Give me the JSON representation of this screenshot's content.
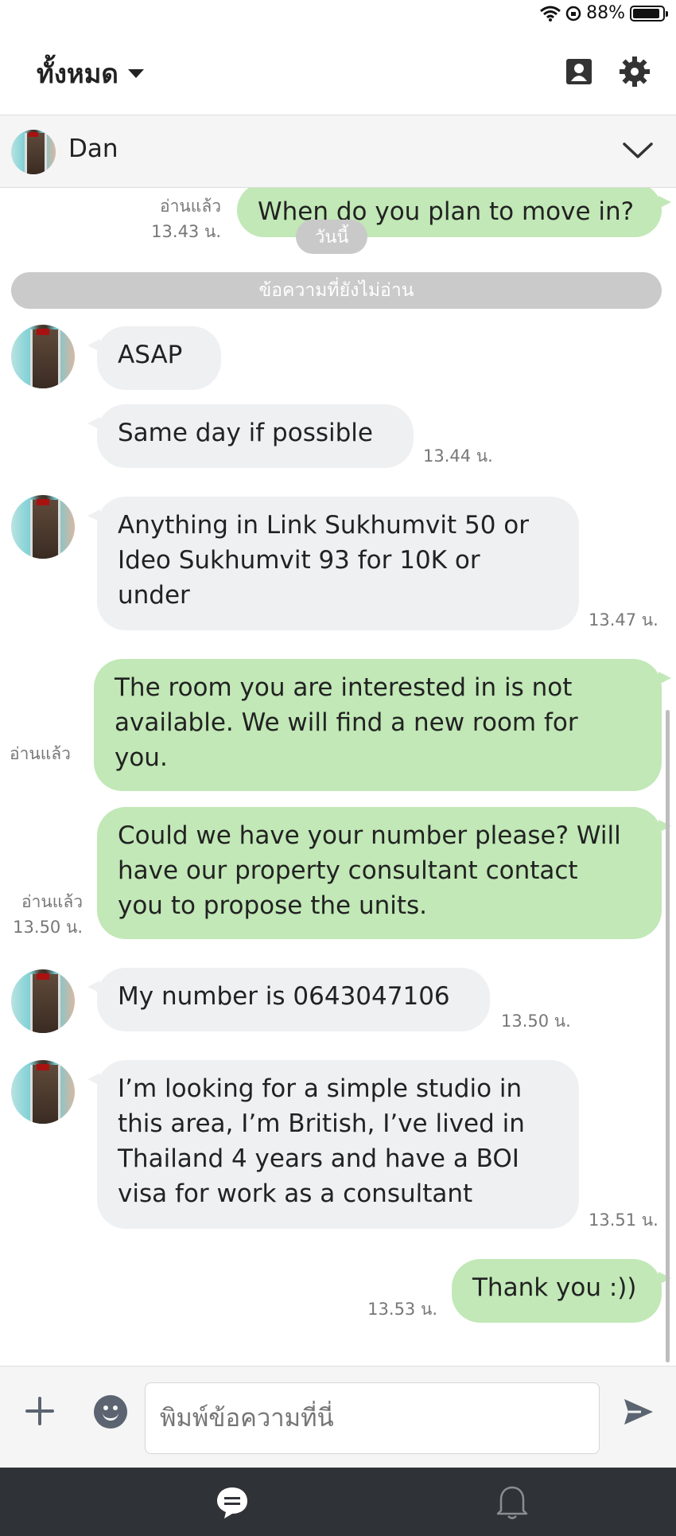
{
  "status_bar": {
    "battery": "88%"
  },
  "header": {
    "title": "ทั้งหมด"
  },
  "contact": {
    "name": "Dan"
  },
  "chat": {
    "date_separator": "วันนี้",
    "unread_separator": "ข้อความที่ยังไม่อ่าน",
    "messages": [
      {
        "from": "me",
        "text": "When do you plan to move in?",
        "read": "อ่านแล้ว",
        "time": "13.43 น."
      },
      {
        "from": "them",
        "text": "ASAP"
      },
      {
        "from": "them",
        "text": "Same day if possible",
        "time": "13.44 น."
      },
      {
        "from": "them",
        "text": "Anything in Link Sukhumvit 50 or\nIdeo Sukhumvit 93 for 10K or\nunder",
        "time": "13.47 น."
      },
      {
        "from": "me",
        "text": "The room you are interested in is not\navailable.  We will find a new room for\nyou.",
        "read": "อ่านแล้ว"
      },
      {
        "from": "me",
        "text": "Could we have your number please? Will\nhave our property consultant contact\nyou to propose the units.",
        "read": "อ่านแล้ว",
        "time": "13.50 น."
      },
      {
        "from": "them",
        "text": "My number is 0643047106",
        "time": "13.50 น."
      },
      {
        "from": "them",
        "text": "I’m looking for a simple studio in\nthis area, I’m British, I’ve lived in\nThailand 4 years and have a BOI\nvisa for work as a consultant",
        "time": "13.51 น."
      },
      {
        "from": "me",
        "text": "Thank you :))",
        "time": "13.53 น."
      }
    ]
  },
  "input": {
    "placeholder": "พิมพ์ข้อความที่นี่"
  },
  "icons": {
    "header": [
      "contacts-icon",
      "gear-icon"
    ],
    "contact_bar": [
      "chevron-down-icon"
    ],
    "input": [
      "plus-icon",
      "emoji-icon",
      "send-icon"
    ],
    "tabs": [
      "chat-icon",
      "bell-icon"
    ]
  },
  "colors": {
    "outgoing_bubble": "#c1e8b6",
    "incoming_bubble": "#eff0f2",
    "tab_bar": "#2f3237"
  }
}
